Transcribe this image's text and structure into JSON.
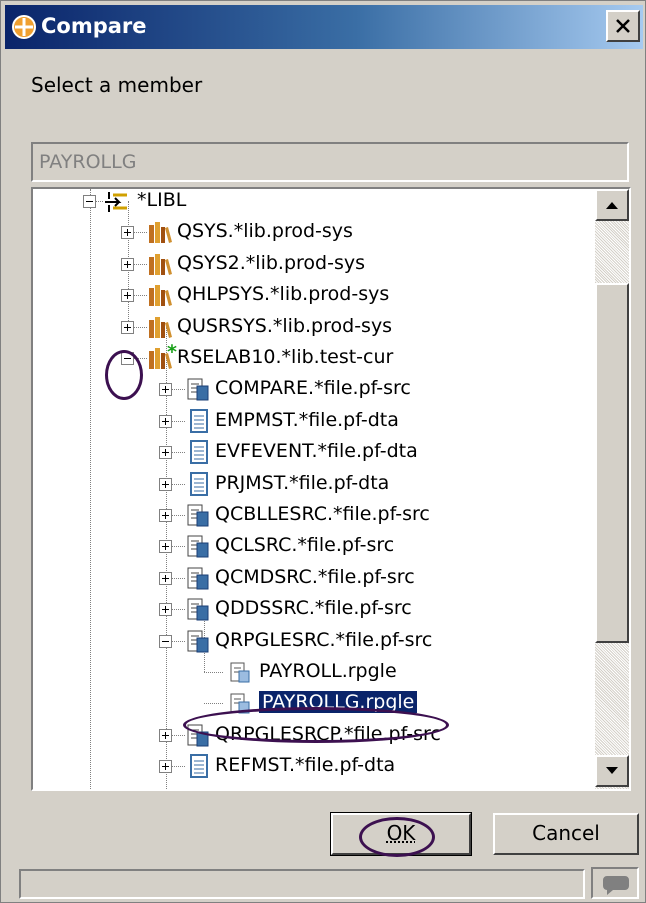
{
  "window": {
    "title": "Compare",
    "close_label": "X"
  },
  "prompt": "Select a member",
  "member_field": {
    "value": "PAYROLLG"
  },
  "tree": {
    "root": "*LIBL",
    "libraries": [
      {
        "label": "QSYS.*lib.prod-sys"
      },
      {
        "label": "QSYS2.*lib.prod-sys"
      },
      {
        "label": "QHLPSYS.*lib.prod-sys"
      },
      {
        "label": "QUSRSYS.*lib.prod-sys"
      },
      {
        "label": "RSELAB10.*lib.test-cur",
        "marker": "*"
      }
    ],
    "files": [
      {
        "label": "COMPARE.*file.pf-src",
        "kind": "src"
      },
      {
        "label": "EMPMST.*file.pf-dta",
        "kind": "dta"
      },
      {
        "label": "EVFEVENT.*file.pf-dta",
        "kind": "dta"
      },
      {
        "label": "PRJMST.*file.pf-dta",
        "kind": "dta"
      },
      {
        "label": "QCBLLESRC.*file.pf-src",
        "kind": "src"
      },
      {
        "label": "QCLSRC.*file.pf-src",
        "kind": "src"
      },
      {
        "label": "QCMDSRC.*file.pf-src",
        "kind": "src"
      },
      {
        "label": "QDDSSRC.*file.pf-src",
        "kind": "src"
      },
      {
        "label": "QRPGLESRC.*file.pf-src",
        "kind": "src"
      },
      {
        "label": "QRPGLESRCP.*file.pf-src",
        "kind": "src"
      },
      {
        "label": "REFMST.*file.pf-dta",
        "kind": "dta"
      }
    ],
    "members": [
      {
        "label": "PAYROLL.rpgle"
      },
      {
        "label": "PAYROLLG.rpgle",
        "selected": true
      }
    ]
  },
  "buttons": {
    "ok": "OK",
    "cancel": "Cancel"
  },
  "colors": {
    "selection": "#0a246a",
    "annotation": "#3c1050",
    "titlebar": "#0a246a"
  }
}
